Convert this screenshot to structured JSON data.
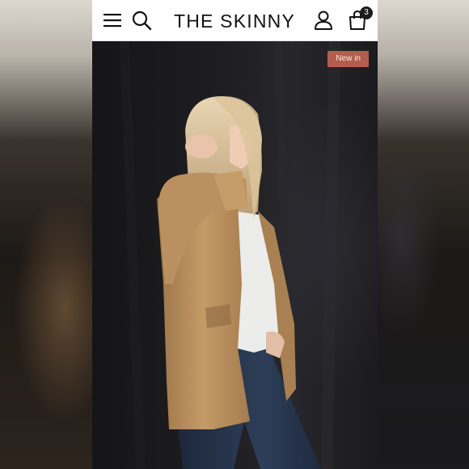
{
  "header": {
    "brand": "THE SKINNY",
    "cart_count": "3",
    "icons": {
      "menu": "hamburger-menu-icon",
      "search": "search-icon",
      "account": "user-icon",
      "cart": "shopping-bag-icon"
    }
  },
  "product_image": {
    "badge": "New in"
  },
  "colors": {
    "header_bg": "#ffffff",
    "badge_bg": "#b35e4d",
    "cardigan": "#b48a5a",
    "jeans": "#26344a"
  }
}
